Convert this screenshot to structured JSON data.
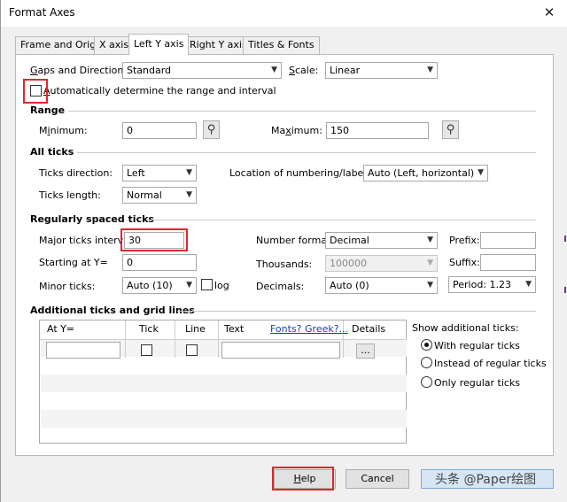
{
  "window": {
    "title": "Format Axes"
  },
  "tabs": [
    {
      "label": "Frame and Origin"
    },
    {
      "label": "X axis"
    },
    {
      "label": "Left Y axis"
    },
    {
      "label": "Right Y axis"
    },
    {
      "label": "Titles & Fonts"
    }
  ],
  "gaps": {
    "label_pre": "",
    "label_g": "G",
    "label_post": "aps and Direction:",
    "value": "Standard"
  },
  "scale": {
    "label_s": "S",
    "label_post": "cale:",
    "value": "Linear"
  },
  "auto_range": {
    "label_a": "A",
    "label_post": "utomatically determine the range and interval",
    "checked": false
  },
  "range": {
    "title": "Range",
    "min_pre": "M",
    "min_u": "i",
    "min_post": "nimum:",
    "min_value": "0",
    "max_pre": "Ma",
    "max_u": "x",
    "max_post": "imum:",
    "max_value": "150"
  },
  "all_ticks": {
    "title": "All ticks",
    "dir_label": "Ticks direction:",
    "dir_value": "Left",
    "length_label": "Ticks length:",
    "length_value": "Normal",
    "location_label": "Location of numbering/labeling:",
    "location_value": "Auto (Left, horizontal)"
  },
  "regular": {
    "title": "Regularly spaced ticks",
    "major_label": "Major ticks interval:",
    "major_value": "30",
    "start_label": "Starting at Y=",
    "start_value": "0",
    "minor_label": "Minor ticks:",
    "minor_value": "Auto (10)",
    "log_label": "log",
    "number_format_label": "Number format:",
    "number_format_value": "Decimal",
    "thousands_label": "Thousands:",
    "thousands_value": "100000",
    "decimals_label": "Decimals:",
    "decimals_value": "Auto (0)",
    "prefix_label": "Prefix:",
    "prefix_value": "",
    "suffix_label": "Suffix:",
    "suffix_value": "",
    "period_value": "Period: 1.23"
  },
  "additional": {
    "title": "Additional ticks and grid lines",
    "col_at": "At Y=",
    "col_tick": "Tick",
    "col_line": "Line",
    "col_text": "Text",
    "fonts_link": "Fonts? Greek?...",
    "col_details": "Details",
    "details_btn": "...",
    "show_label": "Show additional ticks:",
    "opt_with": "With regular ticks",
    "opt_instead": "Instead of regular ticks",
    "opt_only": "Only regular ticks"
  },
  "buttons": {
    "help_h": "H",
    "help_rest": "elp",
    "cancel": "Cancel"
  },
  "watermark": "头条 @Paper绘图"
}
